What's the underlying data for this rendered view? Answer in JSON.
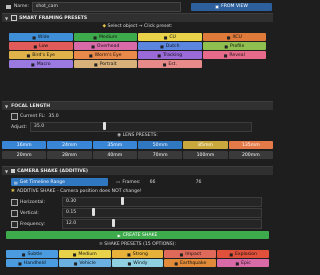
{
  "top": {
    "name_label": "Name:",
    "name_value": "shot_cam",
    "view_button": "FROM VIEW"
  },
  "framing": {
    "title": "SMART FRAMING PRESETS",
    "hint": "Select object → Click preset:",
    "buttons": [
      {
        "label": "Wide",
        "color": "#3f8fd8",
        "icon": "arrows-expand-icon"
      },
      {
        "label": "Medium",
        "color": "#3daa4b",
        "icon": "frame-icon"
      },
      {
        "label": "CU",
        "color": "#e8d24a",
        "icon": "person-icon"
      },
      {
        "label": "XCU",
        "color": "#e07a3a",
        "icon": "eye-icon"
      },
      {
        "label": "Low",
        "color": "#e25b5b",
        "icon": "arrow-up-icon"
      },
      {
        "label": "Overhead",
        "color": "#d86aa8",
        "icon": "arrow-down-icon"
      },
      {
        "label": "Dutch",
        "color": "#5b86e0",
        "icon": "tilt-icon"
      },
      {
        "label": "Profile",
        "color": "#8fbf4f",
        "icon": "profile-icon"
      },
      {
        "label": "Bird's Eye",
        "color": "#e0b34a",
        "icon": "bird-icon"
      },
      {
        "label": "Worm's Eye",
        "color": "#ea8a4a",
        "icon": "worm-icon"
      },
      {
        "label": "Tracking",
        "color": "#9a6ad8",
        "icon": "track-icon"
      },
      {
        "label": "Reveal",
        "color": "#e86a8a",
        "icon": "reveal-icon"
      },
      {
        "label": "Macro",
        "color": "#9a7ae0",
        "icon": "macro-icon"
      },
      {
        "label": "Portrait",
        "color": "#d7b07a",
        "icon": "portrait-icon"
      },
      {
        "label": "Est.",
        "color": "#e98a8a",
        "icon": "establish-icon"
      }
    ]
  },
  "focal": {
    "title": "FOCAL LENGTH",
    "current_label": "Current FL:",
    "current_value": "35.0",
    "adjust_label": "Adjust:",
    "adjust_value": "35.0",
    "adjust_level": 0.33,
    "lens_title": "LENS PRESETS:",
    "lens_row1": [
      "16mm",
      "24mm",
      "35mm",
      "50mm",
      "85mm",
      "135mm"
    ],
    "lens_row1_colors": [
      "#3a86d6",
      "#3a86d6",
      "#3a86d6",
      "#2f77c0",
      "#c9a93e",
      "#e47a48"
    ],
    "lens_row2": [
      "20mm",
      "28mm",
      "40mm",
      "70mm",
      "100mm",
      "200mm"
    ]
  },
  "shake": {
    "title": "CAMERA SHAKE (ADDITIVE)",
    "timeline_button": "Get Timeline Range",
    "frames_label": "Frames:",
    "frame_start": "66",
    "frame_end": "76",
    "additive_label": "ADDITIVE SHAKE - Camera position does NOT change!",
    "horizontal_label": "Horizontal:",
    "horizontal_value": "0.30",
    "horizontal_level": 0.3,
    "vertical_label": "Vertical:",
    "vertical_value": "0.15",
    "vertical_level": 0.15,
    "frequency_label": "Frequency:",
    "frequency_value": "12.0",
    "frequency_level": 0.25,
    "create_button": "CREATE SHAKE",
    "presets_title": "SHAKE PRESETS (15 OPTIONS):",
    "presets": [
      {
        "label": "Subtle",
        "color": "#4a9be0"
      },
      {
        "label": "Medium",
        "color": "#e8d24a"
      },
      {
        "label": "Strong",
        "color": "#e8b23a"
      },
      {
        "label": "Impact",
        "color": "#e06a5a"
      },
      {
        "label": "Explosion",
        "color": "#e0503a"
      },
      {
        "label": "Handheld",
        "color": "#4a9be0"
      },
      {
        "label": "Vehicle",
        "color": "#6ab0e0"
      },
      {
        "label": "Windy",
        "color": "#8fd0e0"
      },
      {
        "label": "Earthquake",
        "color": "#e08a3a"
      },
      {
        "label": "Epic",
        "color": "#d86aa8"
      }
    ]
  }
}
